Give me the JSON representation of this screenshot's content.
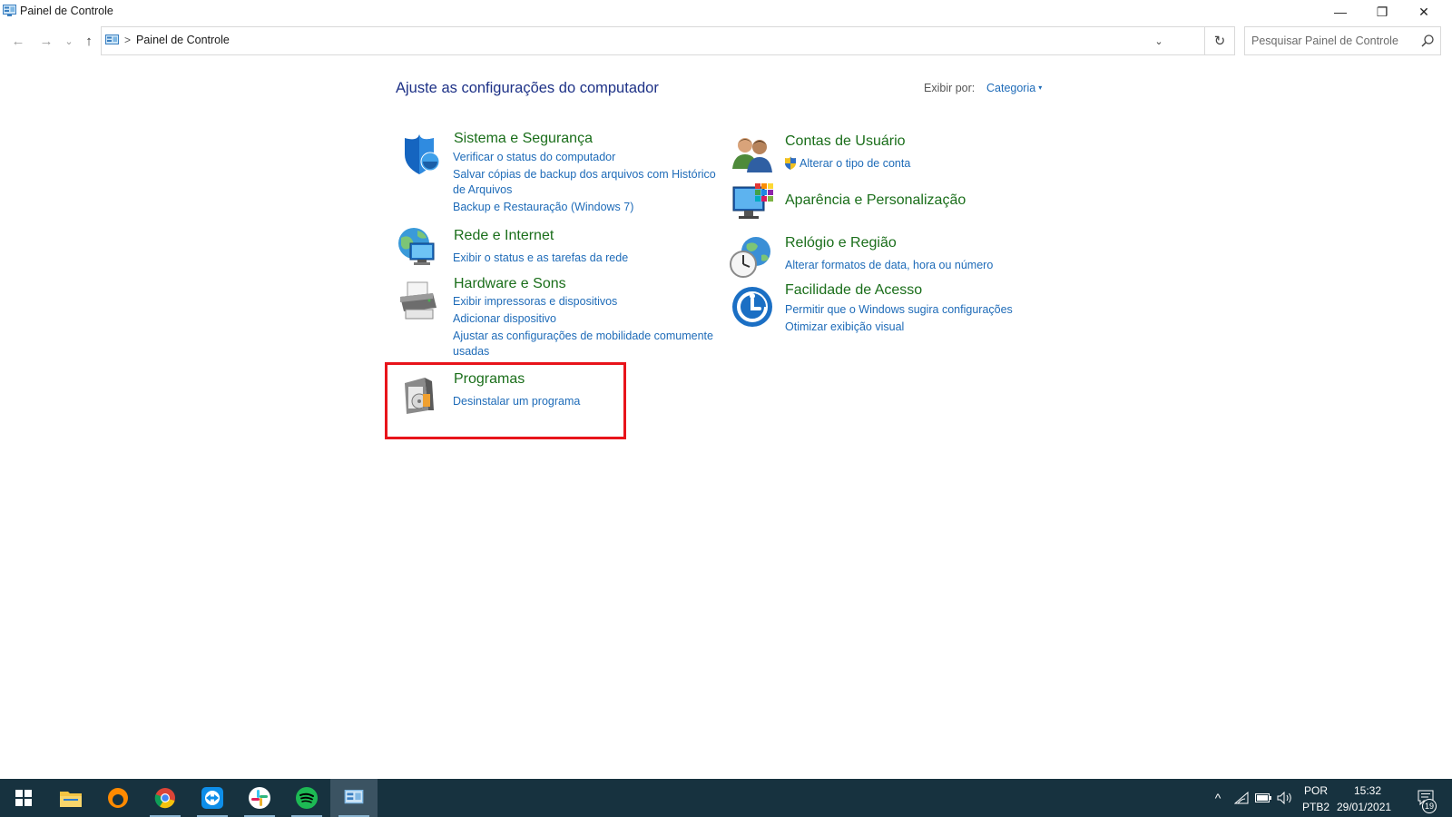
{
  "window": {
    "title": "Painel de Controle",
    "minimize_symbol": "—",
    "maximize_symbol": "❐",
    "close_symbol": "✕"
  },
  "navigation": {
    "back_symbol": "←",
    "forward_symbol": "→",
    "recent_symbol": "⌄",
    "up_symbol": "↑",
    "breadcrumb_separator": ">",
    "breadcrumb": [
      "Painel de Controle"
    ],
    "address_dropdown_symbol": "⌄",
    "refresh_symbol": "↻",
    "search_placeholder": "Pesquisar Painel de Controle"
  },
  "main": {
    "heading": "Ajuste as configurações do computador",
    "view_by_label": "Exibir por:",
    "view_by_value": "Categoria",
    "view_by_caret": "▾",
    "categories_left": [
      {
        "title": "Sistema e Segurança",
        "icon": "shield-icon",
        "links": [
          "Verificar o status do computador",
          "Salvar cópias de backup dos arquivos com Histórico",
          "de Arquivos",
          "Backup e Restauração (Windows 7)"
        ]
      },
      {
        "title": "Rede e Internet",
        "icon": "network-icon",
        "links": [
          "Exibir o status e as tarefas da rede"
        ]
      },
      {
        "title": "Hardware e Sons",
        "icon": "printer-icon",
        "links": [
          "Exibir impressoras e dispositivos",
          "Adicionar dispositivo",
          "Ajustar as configurações de mobilidade comumente",
          "usadas"
        ]
      },
      {
        "title": "Programas",
        "icon": "programs-icon",
        "links": [
          "Desinstalar um programa"
        ]
      }
    ],
    "categories_right": [
      {
        "title": "Contas de Usuário",
        "icon": "users-icon",
        "links": [
          "Alterar o tipo de conta"
        ]
      },
      {
        "title": "Aparência e Personalização",
        "icon": "appearance-icon",
        "links": []
      },
      {
        "title": "Relógio e Região",
        "icon": "clock-globe-icon",
        "links": [
          "Alterar formatos de data, hora ou número"
        ]
      },
      {
        "title": "Facilidade de Acesso",
        "icon": "ease-of-access-icon",
        "links": [
          "Permitir que o Windows sugira configurações",
          "Otimizar exibição visual"
        ]
      }
    ],
    "highlight_color": "#e8141b"
  },
  "taskbar": {
    "apps": [
      "windows-start-icon",
      "file-explorer-icon",
      "firefox-icon",
      "chrome-icon",
      "teamviewer-icon",
      "slack-icon",
      "spotify-icon",
      "control-panel-icon"
    ],
    "tray_chevron": "^",
    "language_top": "POR",
    "language_bottom": "PTB2",
    "time": "15:32",
    "date": "29/01/2021",
    "notification_count": "19"
  },
  "colors": {
    "title_green": "#1a6e1a",
    "link_blue": "#1e6bb8",
    "heading_blue": "#1e3287",
    "taskbar_bg": "#17323f"
  }
}
